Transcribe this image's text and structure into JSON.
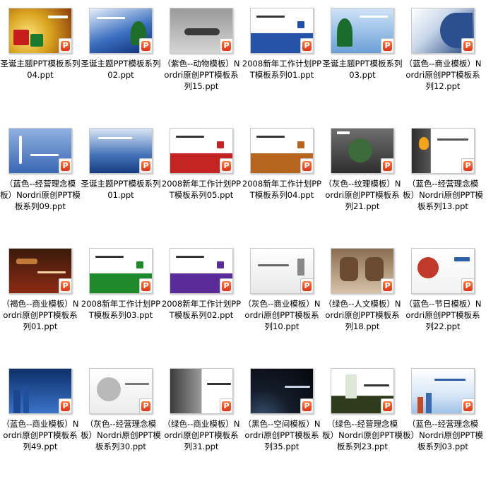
{
  "files": [
    {
      "name": "圣诞主题PPT模板系列04.ppt",
      "theme": "christmas-gold"
    },
    {
      "name": "圣诞主题PPT模板系列02.ppt",
      "theme": "christmas-blue-tree"
    },
    {
      "name": "（紫色--动物模板）Nordri原创PPT模板系列15.ppt",
      "theme": "gray-animal"
    },
    {
      "name": "2008新年工作计划PPT模板系列01.ppt",
      "theme": "plan-blue"
    },
    {
      "name": "圣诞主题PPT模板系列03.ppt",
      "theme": "christmas-tree-blue"
    },
    {
      "name": "（蓝色--商业模板）Nordri原创PPT模板系列12.ppt",
      "theme": "blue-business-curve"
    },
    {
      "name": "（蓝色--经营理念模板）Nordri原创PPT模板系列09.ppt",
      "theme": "blue-clock"
    },
    {
      "name": "圣诞主题PPT模板系列01.ppt",
      "theme": "blue-snow"
    },
    {
      "name": "2008新年工作计划PPT模板系列05.ppt",
      "theme": "plan-red"
    },
    {
      "name": "2008新年工作计划PPT模板系列04.ppt",
      "theme": "plan-orange"
    },
    {
      "name": "（灰色--纹理模板）Nordri原创PPT模板系列21.ppt",
      "theme": "gray-texture"
    },
    {
      "name": "（蓝色--经营理念模板）Nordri原创PPT模板系列13.ppt",
      "theme": "bulb"
    },
    {
      "name": "（褐色--商业模板）Nordri原创PPT模板系列01.ppt",
      "theme": "brown-gavel"
    },
    {
      "name": "2008新年工作计划PPT模板系列03.ppt",
      "theme": "plan-green"
    },
    {
      "name": "2008新年工作计划PPT模板系列02.ppt",
      "theme": "plan-purple"
    },
    {
      "name": "（灰色--商业模板）Nordri原创PPT模板系列10.ppt",
      "theme": "gray-business"
    },
    {
      "name": "（绿色--人文模板）Nordri原创PPT模板系列18.ppt",
      "theme": "hands"
    },
    {
      "name": "（蓝色--节日模板）Nordri原创PPT模板系列22.ppt",
      "theme": "flowers"
    },
    {
      "name": "（蓝色--商业模板）Nordri原创PPT模板系列49.ppt",
      "theme": "blue-city"
    },
    {
      "name": "（灰色--经营理念模板）Nordri原创PPT模板系列30.ppt",
      "theme": "gray-spiral"
    },
    {
      "name": "（绿色--商业模板）Nordri原创PPT模板系列31.ppt",
      "theme": "gray-building"
    },
    {
      "name": "（黑色--空间模板）Nordri原创PPT模板系列35.ppt",
      "theme": "space"
    },
    {
      "name": "（绿色--经营理念模板）Nordri原创PPT模板系列23.ppt",
      "theme": "green-door"
    },
    {
      "name": "（蓝色--经营理念模板）Nordri原创PPT模板系列03.ppt",
      "theme": "skyline"
    }
  ],
  "badge_letter": "P",
  "colors": {
    "background": "#ffffff",
    "text": "#000000",
    "ppt_badge": "#e0461f"
  }
}
